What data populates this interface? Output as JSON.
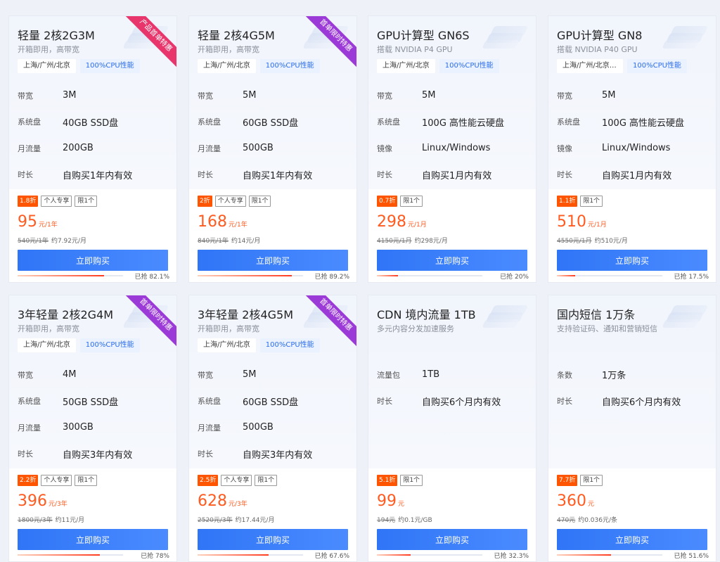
{
  "common": {
    "buy_label": "立即购买",
    "sold_prefix": "已抢 ",
    "approx_prefix": "约"
  },
  "cards": [
    {
      "title": "轻量 2核2G3M",
      "subtitle": "开箱即用，高带宽",
      "tags": [
        "上海/广州/北京",
        "100%CPU性能"
      ],
      "specs": [
        {
          "k": "带宽",
          "v": "3M"
        },
        {
          "k": "系统盘",
          "v": "40GB SSD盘"
        },
        {
          "k": "月流量",
          "v": "200GB"
        },
        {
          "k": "时长",
          "v": "自购买1年内有效"
        }
      ],
      "ribbon": "产品首单特惠",
      "ribbon_color": "#e8366d",
      "discount": "1.8折",
      "labels": [
        "个人专享",
        "限1个"
      ],
      "price": "95",
      "unit": "元/1年",
      "orig": "540元/1年",
      "approx": "约7.92元/月",
      "sold": "82.1%",
      "sold_fraction": 0.821
    },
    {
      "title": "轻量 2核4G5M",
      "subtitle": "开箱即用，高带宽",
      "tags": [
        "上海/广州/北京",
        "100%CPU性能"
      ],
      "specs": [
        {
          "k": "带宽",
          "v": "5M"
        },
        {
          "k": "系统盘",
          "v": "60GB SSD盘"
        },
        {
          "k": "月流量",
          "v": "500GB"
        },
        {
          "k": "时长",
          "v": "自购买1年内有效"
        }
      ],
      "ribbon": "首单限时特惠",
      "ribbon_color": "#9c3ad8",
      "discount": "2折",
      "labels": [
        "个人专享",
        "限1个"
      ],
      "price": "168",
      "unit": "元/1年",
      "orig": "840元/1年",
      "approx": "约14元/月",
      "sold": "89.2%",
      "sold_fraction": 0.892
    },
    {
      "title": "GPU计算型 GN6S",
      "subtitle": "搭载 NVIDIA P4 GPU",
      "tags": [
        "上海/广州/北京",
        "100%CPU性能"
      ],
      "specs": [
        {
          "k": "带宽",
          "v": "5M"
        },
        {
          "k": "系统盘",
          "v": "100G 高性能云硬盘"
        },
        {
          "k": "镜像",
          "v": "Linux/Windows"
        },
        {
          "k": "时长",
          "v": "自购买1月内有效"
        }
      ],
      "ribbon": "",
      "ribbon_color": "",
      "discount": "0.7折",
      "labels": [
        "限1个"
      ],
      "price": "298",
      "unit": "元/1月",
      "orig": "4150元/1月",
      "approx": "约298元/月",
      "sold": "20%",
      "sold_fraction": 0.2
    },
    {
      "title": "GPU计算型 GN8",
      "subtitle": "搭载 NVIDIA P40 GPU",
      "tags": [
        "上海/广州/北京/中国...",
        "100%CPU性能"
      ],
      "specs": [
        {
          "k": "带宽",
          "v": "5M"
        },
        {
          "k": "系统盘",
          "v": "100G 高性能云硬盘"
        },
        {
          "k": "镜像",
          "v": "Linux/Windows"
        },
        {
          "k": "时长",
          "v": "自购买1月内有效"
        }
      ],
      "ribbon": "",
      "ribbon_color": "",
      "discount": "1.1折",
      "labels": [
        "限1个"
      ],
      "price": "510",
      "unit": "元/1月",
      "orig": "4550元/1月",
      "approx": "约510元/月",
      "sold": "17.5%",
      "sold_fraction": 0.175
    },
    {
      "title": "3年轻量 2核2G4M",
      "subtitle": "开箱即用，高带宽",
      "tags": [
        "上海/广州/北京",
        "100%CPU性能"
      ],
      "specs": [
        {
          "k": "带宽",
          "v": "4M"
        },
        {
          "k": "系统盘",
          "v": "50GB SSD盘"
        },
        {
          "k": "月流量",
          "v": "300GB"
        },
        {
          "k": "时长",
          "v": "自购买3年内有效"
        }
      ],
      "ribbon": "首单限时特惠",
      "ribbon_color": "#9c3ad8",
      "discount": "2.2折",
      "labels": [
        "个人专享",
        "限1个"
      ],
      "price": "396",
      "unit": "元/3年",
      "orig": "1800元/3年",
      "approx": "约11元/月",
      "sold": "78%",
      "sold_fraction": 0.78
    },
    {
      "title": "3年轻量 2核4G5M",
      "subtitle": "开箱即用，高带宽",
      "tags": [
        "上海/广州/北京",
        "100%CPU性能"
      ],
      "specs": [
        {
          "k": "带宽",
          "v": "5M"
        },
        {
          "k": "系统盘",
          "v": "60GB SSD盘"
        },
        {
          "k": "月流量",
          "v": "500GB"
        },
        {
          "k": "时长",
          "v": "自购买3年内有效"
        }
      ],
      "ribbon": "首单限时特惠",
      "ribbon_color": "#9c3ad8",
      "discount": "2.5折",
      "labels": [
        "个人专享",
        "限1个"
      ],
      "price": "628",
      "unit": "元/3年",
      "orig": "2520元/3年",
      "approx": "约17.44元/月",
      "sold": "67.6%",
      "sold_fraction": 0.676
    },
    {
      "title": "CDN 境内流量 1TB",
      "subtitle": "多元内容分发加速服务",
      "tags": [],
      "specs": [
        {
          "k": "流量包",
          "v": "1TB"
        },
        {
          "k": "时长",
          "v": "自购买6个月内有效"
        }
      ],
      "ribbon": "",
      "ribbon_color": "",
      "discount": "5.1折",
      "labels": [
        "限1个"
      ],
      "price": "99",
      "unit": "元",
      "orig": "194元",
      "approx": "约0.1元/GB",
      "sold": "32.3%",
      "sold_fraction": 0.323
    },
    {
      "title": "国内短信 1万条",
      "subtitle": "支持验证码、通知和营销短信",
      "tags": [],
      "specs": [
        {
          "k": "条数",
          "v": "1万条"
        },
        {
          "k": "时长",
          "v": "自购买6个月内有效"
        }
      ],
      "ribbon": "",
      "ribbon_color": "",
      "discount": "7.7折",
      "labels": [
        "限1个"
      ],
      "price": "360",
      "unit": "元",
      "orig": "470元",
      "approx": "约0.036元/条",
      "sold": "51.6%",
      "sold_fraction": 0.516
    }
  ]
}
